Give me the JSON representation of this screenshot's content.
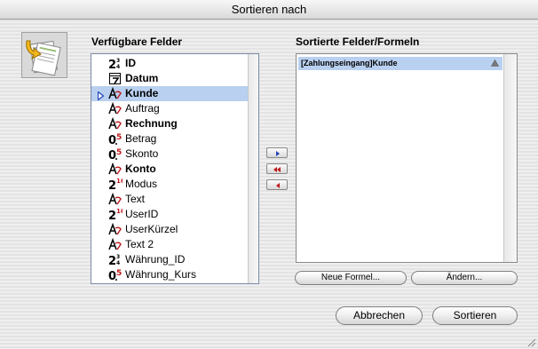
{
  "window": {
    "title": "Sortieren nach"
  },
  "available": {
    "label": "Verfügbare Felder",
    "fields": [
      {
        "name": "ID",
        "icon": "integer-type-icon",
        "bold": true,
        "selected": false
      },
      {
        "name": "Datum",
        "icon": "date-type-icon",
        "bold": true,
        "selected": false
      },
      {
        "name": "Kunde",
        "icon": "text-type-icon",
        "bold": true,
        "selected": true
      },
      {
        "name": "Auftrag",
        "icon": "text-type-icon",
        "bold": false,
        "selected": false
      },
      {
        "name": "Rechnung",
        "icon": "text-type-icon",
        "bold": true,
        "selected": false
      },
      {
        "name": "Betrag",
        "icon": "real-type-icon",
        "bold": false,
        "selected": false
      },
      {
        "name": "Skonto",
        "icon": "real-type-icon",
        "bold": false,
        "selected": false
      },
      {
        "name": "Konto",
        "icon": "text-type-icon",
        "bold": true,
        "selected": false
      },
      {
        "name": "Modus",
        "icon": "longint-type-icon",
        "bold": false,
        "selected": false
      },
      {
        "name": "Text",
        "icon": "text-type-icon",
        "bold": false,
        "selected": false
      },
      {
        "name": "UserID",
        "icon": "longint-type-icon",
        "bold": false,
        "selected": false
      },
      {
        "name": "UserKürzel",
        "icon": "text-type-icon",
        "bold": false,
        "selected": false
      },
      {
        "name": "Text 2",
        "icon": "text-type-icon",
        "bold": false,
        "selected": false
      },
      {
        "name": "Währung_ID",
        "icon": "integer-type-icon",
        "bold": false,
        "selected": false
      },
      {
        "name": "Währung_Kurs",
        "icon": "real-type-icon",
        "bold": false,
        "selected": false
      }
    ]
  },
  "move_buttons": [
    {
      "name": "add-field-button",
      "icon": "arrow-right-icon"
    },
    {
      "name": "remove-all-button",
      "icon": "double-arrow-left-icon"
    },
    {
      "name": "remove-field-button",
      "icon": "arrow-left-icon"
    }
  ],
  "sorted": {
    "label": "Sortierte Felder/Formeln",
    "rows": [
      {
        "text": "[Zahlungseingang]Kunde",
        "order_icon": "ascending-triangle-icon"
      }
    ]
  },
  "buttons": {
    "new_formula": "Neue Formel...",
    "edit": "Ändern...",
    "cancel": "Abbrechen",
    "sort": "Sortieren"
  },
  "colors": {
    "selection": "#b9d0f0",
    "icon_red": "#c0181a",
    "pointer_blue": "#1f44b8"
  }
}
